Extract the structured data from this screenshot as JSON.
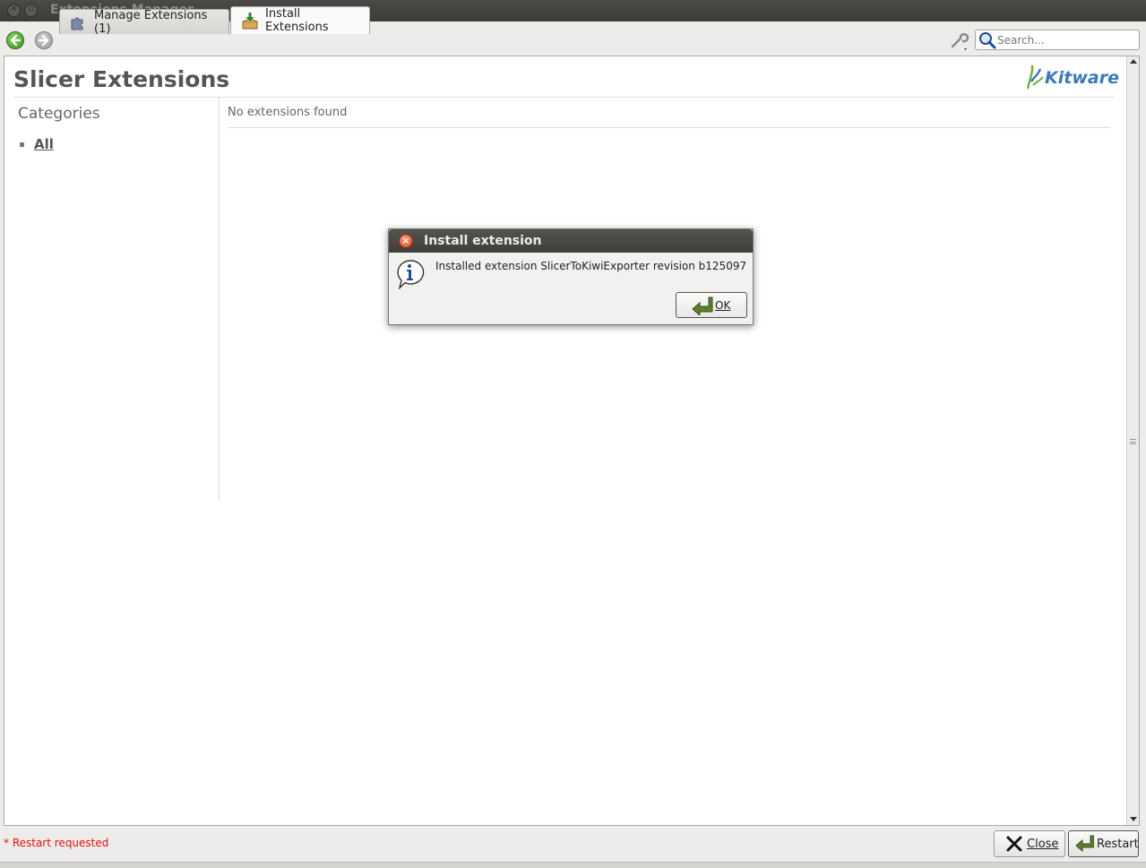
{
  "window": {
    "title": "Extensions Manager"
  },
  "toolbar": {
    "tabs": [
      {
        "label": "Manage Extensions (1)",
        "icon": "puzzle-icon"
      },
      {
        "label": "Install Extensions",
        "icon": "install-box-icon"
      }
    ],
    "search": {
      "placeholder": "Search...",
      "value": ""
    }
  },
  "main": {
    "title": "Slicer Extensions",
    "logo_text": "Kitware",
    "categories_heading": "Categories",
    "categories": [
      {
        "label": "All"
      }
    ],
    "empty_message": "No extensions found"
  },
  "dialog": {
    "title": "Install extension",
    "message": "Installed extension SlicerToKiwiExporter revision b125097",
    "ok_label": "OK"
  },
  "footer": {
    "status": "* Restart requested",
    "close_label": "Close",
    "restart_label": "Restart"
  },
  "colors": {
    "status_red": "#e01010",
    "accent_blue": "#3c79b5",
    "title_bar": "#3c3b37"
  }
}
